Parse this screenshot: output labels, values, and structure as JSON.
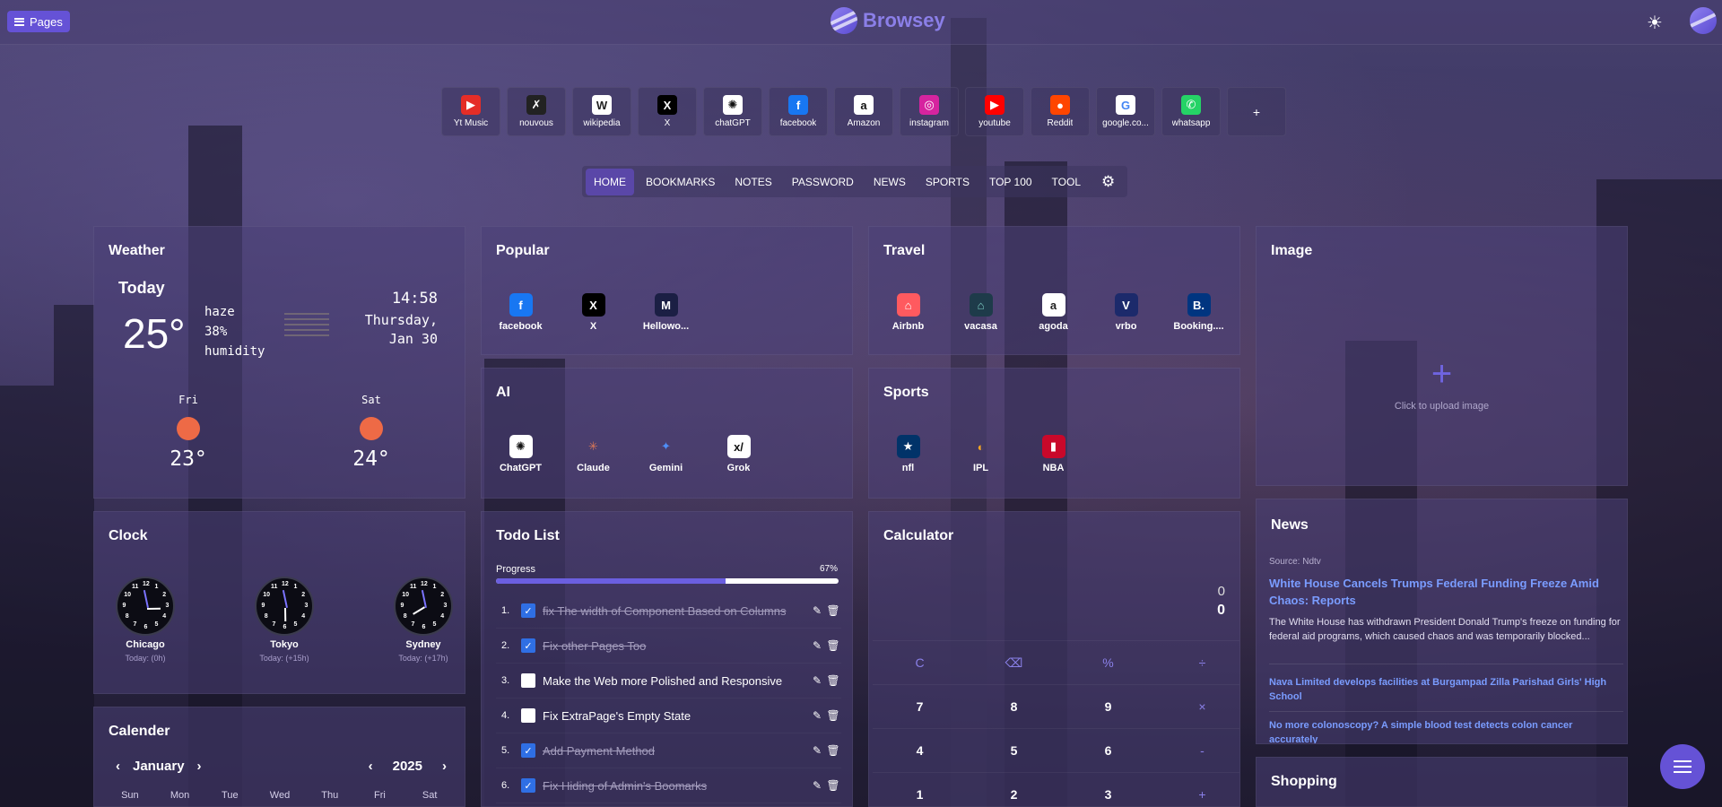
{
  "header": {
    "pages_label": "Pages",
    "brand": "Browsey"
  },
  "shortcuts": [
    {
      "label": "Yt Music",
      "icon": "yt-music-icon",
      "glyph": "▶",
      "bg": "#e52d27",
      "fg": "#fff"
    },
    {
      "label": "nouvous",
      "icon": "nouvous-icon",
      "glyph": "✗",
      "bg": "#222",
      "fg": "#fff"
    },
    {
      "label": "wikipedia",
      "icon": "wikipedia-icon",
      "glyph": "W",
      "bg": "#fff",
      "fg": "#222"
    },
    {
      "label": "X",
      "icon": "x-icon",
      "glyph": "X",
      "bg": "#000",
      "fg": "#fff"
    },
    {
      "label": "chatGPT",
      "icon": "chatgpt-icon",
      "glyph": "✺",
      "bg": "#fff",
      "fg": "#111"
    },
    {
      "label": "facebook",
      "icon": "facebook-icon",
      "glyph": "f",
      "bg": "#1877f2",
      "fg": "#fff"
    },
    {
      "label": "Amazon",
      "icon": "amazon-icon",
      "glyph": "a",
      "bg": "#fff",
      "fg": "#111"
    },
    {
      "label": "instagram",
      "icon": "instagram-icon",
      "glyph": "◎",
      "bg": "#d6249f",
      "fg": "#fff"
    },
    {
      "label": "youtube",
      "icon": "youtube-icon",
      "glyph": "▶",
      "bg": "#ff0000",
      "fg": "#fff"
    },
    {
      "label": "Reddit",
      "icon": "reddit-icon",
      "glyph": "●",
      "bg": "#ff4500",
      "fg": "#fff"
    },
    {
      "label": "google.co...",
      "icon": "google-icon",
      "glyph": "G",
      "bg": "#fff",
      "fg": "#4285f4"
    },
    {
      "label": "whatsapp",
      "icon": "whatsapp-icon",
      "glyph": "✆",
      "bg": "#25d366",
      "fg": "#fff"
    }
  ],
  "shortcut_add": "+",
  "nav": [
    "HOME",
    "BOOKMARKS",
    "NOTES",
    "PASSWORD",
    "NEWS",
    "SPORTS",
    "TOP 100",
    "TOOL"
  ],
  "weather": {
    "title": "Weather",
    "today_label": "Today",
    "temp": "25°",
    "condition": "haze",
    "humidity": "38%",
    "humidity_label": "humidity",
    "time": "14:58",
    "day": "Thursday,",
    "date": "Jan 30",
    "forecast": [
      {
        "day": "Fri",
        "temp": "23°"
      },
      {
        "day": "Sat",
        "temp": "24°"
      }
    ]
  },
  "popular": {
    "title": "Popular",
    "items": [
      {
        "label": "facebook",
        "icon": "facebook-icon",
        "glyph": "f",
        "bg": "#1877f2",
        "fg": "#fff"
      },
      {
        "label": "X",
        "icon": "x-icon",
        "glyph": "X",
        "bg": "#000",
        "fg": "#fff"
      },
      {
        "label": "Hellowo...",
        "icon": "hellowork-icon",
        "glyph": "M",
        "bg": "#1b1f44",
        "fg": "#fff"
      }
    ]
  },
  "travel": {
    "title": "Travel",
    "items": [
      {
        "label": "Airbnb",
        "icon": "airbnb-icon",
        "glyph": "⌂",
        "bg": "#ff5a5f",
        "fg": "#fff"
      },
      {
        "label": "vacasa",
        "icon": "vacasa-icon",
        "glyph": "⌂",
        "bg": "#1e3b4a",
        "fg": "#7fd1c8"
      },
      {
        "label": "agoda",
        "icon": "agoda-icon",
        "glyph": "a",
        "bg": "#fff",
        "fg": "#222"
      },
      {
        "label": "vrbo",
        "icon": "vrbo-icon",
        "glyph": "V",
        "bg": "#1c2a6b",
        "fg": "#fff"
      },
      {
        "label": "Booking....",
        "icon": "booking-icon",
        "glyph": "B.",
        "bg": "#003580",
        "fg": "#fff"
      }
    ]
  },
  "ai": {
    "title": "AI",
    "items": [
      {
        "label": "ChatGPT",
        "icon": "chatgpt-icon",
        "glyph": "✺",
        "bg": "#fff",
        "fg": "#111"
      },
      {
        "label": "Claude",
        "icon": "claude-icon",
        "glyph": "✳",
        "bg": "transparent",
        "fg": "#d97757"
      },
      {
        "label": "Gemini",
        "icon": "gemini-icon",
        "glyph": "✦",
        "bg": "transparent",
        "fg": "#4f8ef7"
      },
      {
        "label": "Grok",
        "icon": "grok-icon",
        "glyph": "x/",
        "bg": "#fff",
        "fg": "#111"
      }
    ]
  },
  "sports": {
    "title": "Sports",
    "items": [
      {
        "label": "nfl",
        "icon": "nfl-icon",
        "glyph": "★",
        "bg": "#013369",
        "fg": "#fff"
      },
      {
        "label": "IPL",
        "icon": "ipl-icon",
        "glyph": "◐",
        "bg": "transparent",
        "fg": "#f5a623"
      },
      {
        "label": "NBA",
        "icon": "nba-icon",
        "glyph": "▮",
        "bg": "#c9082a",
        "fg": "#fff"
      }
    ]
  },
  "image": {
    "title": "Image",
    "plus": "+",
    "hint": "Click to upload image"
  },
  "clock": {
    "title": "Clock",
    "clocks": [
      {
        "city": "Chicago",
        "offset": "Today: (0h)",
        "hour": 2,
        "minute": 58
      },
      {
        "city": "Tokyo",
        "offset": "Today: (+15h)",
        "hour": 5,
        "minute": 58
      },
      {
        "city": "Sydney",
        "offset": "Today: (+17h)",
        "hour": 7,
        "minute": 58
      }
    ]
  },
  "todo": {
    "title": "Todo List",
    "progress_label": "Progress",
    "progress_text": "67%",
    "progress": 0.67,
    "items": [
      {
        "num": "1.",
        "text": "fix The width of Component Based on Columns",
        "done": true
      },
      {
        "num": "2.",
        "text": "Fix other Pages Too",
        "done": true
      },
      {
        "num": "3.",
        "text": "Make the Web more Polished and Responsive",
        "done": false
      },
      {
        "num": "4.",
        "text": "Fix ExtraPage's Empty State",
        "done": false
      },
      {
        "num": "5.",
        "text": "Add Payment Method",
        "done": true
      },
      {
        "num": "6.",
        "text": "Fix Hiding of Admin's Boomarks",
        "done": true
      }
    ]
  },
  "calculator": {
    "title": "Calculator",
    "previous": "0",
    "current": "0",
    "keys": [
      {
        "label": "C",
        "op": true
      },
      {
        "label": "⌫",
        "op": true
      },
      {
        "label": "%",
        "op": true
      },
      {
        "label": "÷",
        "op": true
      },
      {
        "label": "7",
        "op": false
      },
      {
        "label": "8",
        "op": false
      },
      {
        "label": "9",
        "op": false
      },
      {
        "label": "×",
        "op": true
      },
      {
        "label": "4",
        "op": false
      },
      {
        "label": "5",
        "op": false
      },
      {
        "label": "6",
        "op": false
      },
      {
        "label": "-",
        "op": true
      },
      {
        "label": "1",
        "op": false
      },
      {
        "label": "2",
        "op": false
      },
      {
        "label": "3",
        "op": false
      },
      {
        "label": "+",
        "op": true
      }
    ]
  },
  "news": {
    "title": "News",
    "source": "Source: Ndtv",
    "main_title": "White House Cancels Trumps Federal Funding Freeze Amid Chaos: Reports",
    "main_body": "The White House has withdrawn President Donald Trump's freeze on funding for federal aid programs, which caused chaos and was temporarily blocked...",
    "links": [
      "Nava Limited develops facilities at Burgampad Zilla Parishad Girls' High School",
      "No more colonoscopy? A simple blood test detects colon cancer accurately"
    ]
  },
  "calendar": {
    "title": "Calender",
    "month": "January",
    "year": "2025",
    "days": [
      "Sun",
      "Mon",
      "Tue",
      "Wed",
      "Thu",
      "Fri",
      "Sat"
    ]
  },
  "shopping": {
    "title": "Shopping"
  }
}
